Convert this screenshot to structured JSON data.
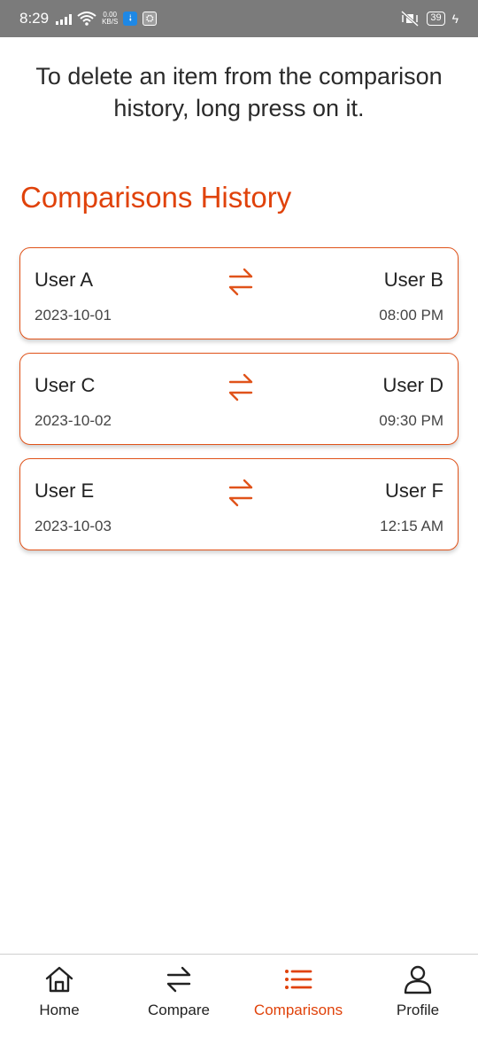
{
  "status_bar": {
    "time": "8:29",
    "net_speed_value": "0.00",
    "net_speed_unit": "KB/S",
    "battery": "39",
    "icons": [
      "signal-icon",
      "wifi-icon",
      "usb-debug-icon",
      "app-icon",
      "mute-vibrate-icon",
      "battery-icon",
      "charging-icon"
    ]
  },
  "notice": "To delete an item from the comparison history, long press on it.",
  "section_title": "Comparisons History",
  "comparisons": [
    {
      "user_left": "User A",
      "user_right": "User B",
      "date": "2023-10-01",
      "time": "08:00 PM"
    },
    {
      "user_left": "User C",
      "user_right": "User D",
      "date": "2023-10-02",
      "time": "09:30 PM"
    },
    {
      "user_left": "User E",
      "user_right": "User F",
      "date": "2023-10-03",
      "time": "12:15 AM"
    }
  ],
  "bottom_nav": {
    "items": [
      {
        "label": "Home",
        "icon": "home-icon"
      },
      {
        "label": "Compare",
        "icon": "swap-arrows-icon"
      },
      {
        "label": "Comparisons",
        "icon": "list-icon",
        "active": true
      },
      {
        "label": "Profile",
        "icon": "person-icon"
      }
    ]
  },
  "colors": {
    "accent": "#e0420a",
    "status_bar_bg": "#7b7b7b",
    "card_border": "#e0531a",
    "text": "#222222"
  }
}
